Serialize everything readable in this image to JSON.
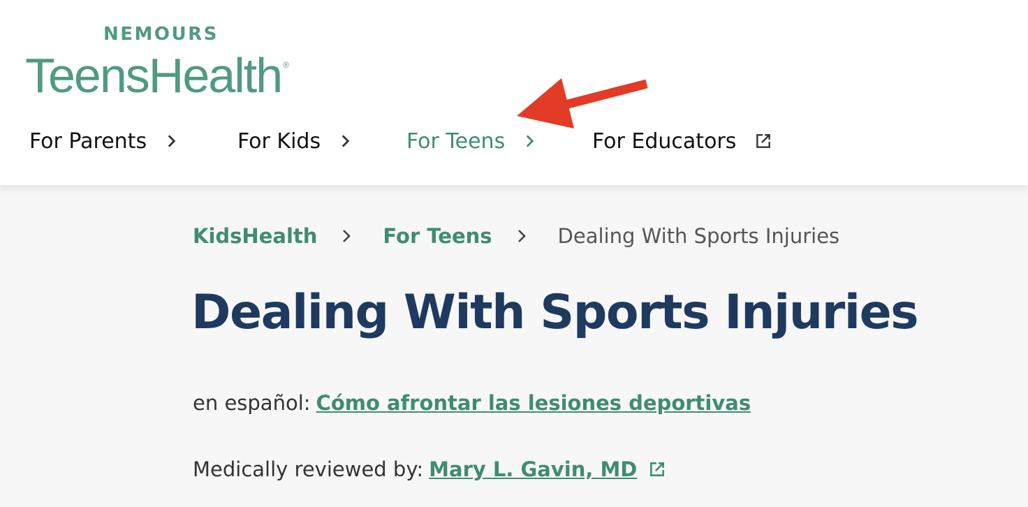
{
  "brand": {
    "top": "NEMOURS",
    "name": "TeensHealth",
    "registered": "®"
  },
  "nav": {
    "items": [
      {
        "label": "For Parents",
        "icon": "chevron-right-icon",
        "active": false
      },
      {
        "label": "For Kids",
        "icon": "chevron-right-icon",
        "active": false
      },
      {
        "label": "For Teens",
        "icon": "chevron-right-icon",
        "active": true
      },
      {
        "label": "For Educators",
        "icon": "external-link-icon",
        "active": false
      }
    ]
  },
  "breadcrumb": {
    "items": [
      "KidsHealth",
      "For Teens"
    ],
    "current": "Dealing With Sports Injuries"
  },
  "article": {
    "title": "Dealing With Sports Injuries",
    "spanish_prefix": "en español:",
    "spanish_link": "Cómo afrontar las lesiones deportivas",
    "reviewed_prefix": "Medically reviewed by:",
    "reviewer": "Mary L. Gavin, MD"
  },
  "colors": {
    "brand_green": "#4f9a82",
    "link_green": "#3f8c73",
    "title_navy": "#1f3a5f",
    "annotation_red": "#e23b26"
  }
}
